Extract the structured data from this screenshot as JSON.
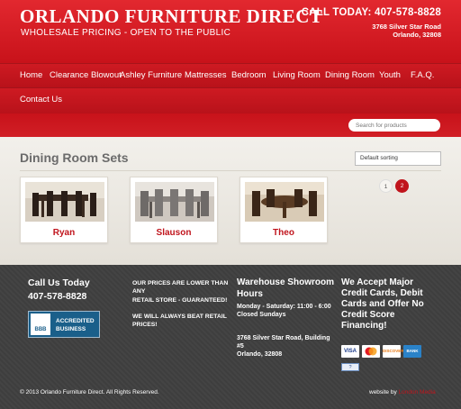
{
  "header": {
    "title": "ORLANDO FURNITURE DIRECT",
    "subtitle": "WHOLESALE PRICING - OPEN TO THE PUBLIC",
    "call": "CALL TODAY: 407-578-8828",
    "address_line1": "3768 Silver Star Road",
    "address_line2": "Orlando, 32808"
  },
  "nav": {
    "items": [
      "Home",
      "Clearance Blowout",
      "Ashley Furniture",
      "Mattresses",
      "Bedroom",
      "Living Room",
      "Dining Room",
      "Youth",
      "F.A.Q.",
      "Contact Us"
    ]
  },
  "search": {
    "placeholder": "Search for products"
  },
  "main": {
    "title": "Dining Room Sets",
    "sort_value": "Default sorting",
    "products": [
      "Ryan",
      "Slauson",
      "Theo"
    ],
    "pages": [
      "1",
      "2"
    ]
  },
  "footer": {
    "call_heading": "Call Us Today",
    "phone": "407-578-8828",
    "bbb_logo": "BBB",
    "bbb_line1": "ACCREDITED",
    "bbb_line2": "BUSINESS",
    "price_1": "OUR PRICES ARE LOWER THAN",
    "price_2": "ANY",
    "price_3": "RETAIL STORE - GUARANTEED!",
    "price_4": "WE WILL ALWAYS BEAT RETAIL",
    "price_5": "PRICES!",
    "ware_1": "Warehouse Showroom",
    "ware_2": "Hours",
    "hours_1": "Monday - Saturday: 11:00 - 6:00",
    "hours_2": "Closed Sundays",
    "waddr_1": "3768 Silver Star Road, Building",
    "waddr_2": "#5",
    "waddr_3": "Orlando, 32808",
    "accept_1": "We Accept Major",
    "accept_2": "Credit Cards, Debit",
    "accept_3": "Cards and Offer No",
    "accept_4": "Credit Score",
    "accept_5": "Financing!",
    "cards": [
      "VISA",
      "",
      "DISCOVER",
      "BANK"
    ],
    "small_icon": "?",
    "copyright": "© 2013 Orlando Furniture Direct. All Rights Reserved.",
    "credit_prefix": "website by",
    "credit_link": "London Media"
  },
  "colors": {
    "brand_red": "#c8121a",
    "footer_bg": "#3e3e3e",
    "link_red": "#c0141c"
  }
}
